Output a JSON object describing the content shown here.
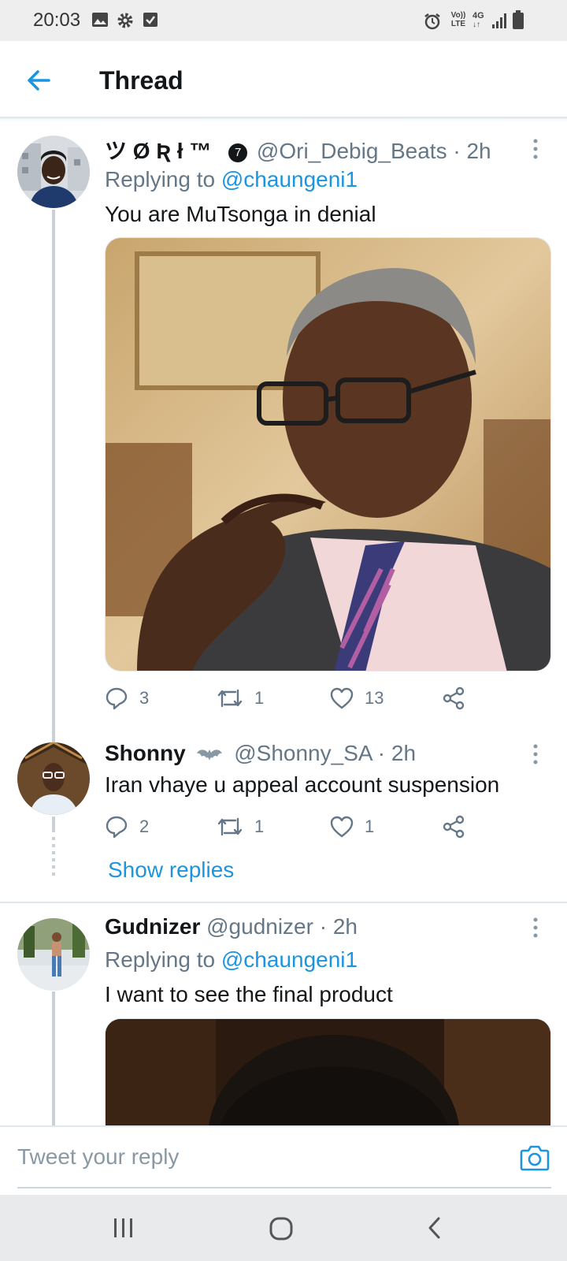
{
  "status_bar": {
    "time": "20:03",
    "icons": [
      "image-icon",
      "gear-icon",
      "checkbox-icon",
      "alarm-icon",
      "volte-icon",
      "4g-icon",
      "signal-icon",
      "battery-icon"
    ],
    "volte_label": "Vo)) LTE",
    "network_label": "4G"
  },
  "app_bar": {
    "title": "Thread",
    "back_icon": "arrow-left-icon"
  },
  "tweets": [
    {
      "name": "ツ Ø Ʀ ł ™",
      "badge": "7",
      "handle": "@Ori_Debig_Beats",
      "time": "· 2h",
      "replying_label": "Replying to",
      "replying_to": "@chaungeni1",
      "text": "You are MuTsonga in denial",
      "replies": "3",
      "retweets": "1",
      "likes": "13"
    },
    {
      "name": "Shonny",
      "handle": "@Shonny_SA",
      "time": "· 2h",
      "text": "Iran vhaye u appeal account suspension",
      "replies": "2",
      "retweets": "1",
      "likes": "1"
    },
    {
      "name": "Gudnizer",
      "handle": "@gudnizer",
      "time": "· 2h",
      "replying_label": "Replying to",
      "replying_to": "@chaungeni1",
      "text": "I want to see the final product"
    }
  ],
  "show_replies": "Show replies",
  "compose": {
    "placeholder": "Tweet your reply",
    "camera_icon": "camera-icon"
  },
  "colors": {
    "accent": "#1b95e0",
    "muted": "#657786",
    "text": "#14171a"
  }
}
